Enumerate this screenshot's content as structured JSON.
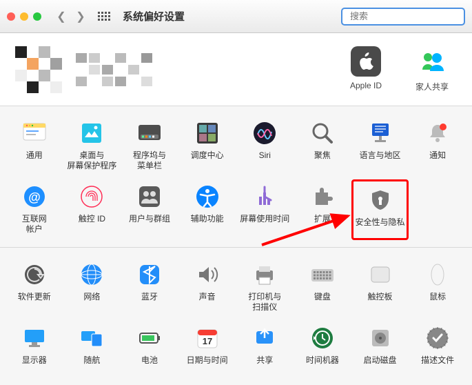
{
  "window": {
    "title": "系统偏好设置",
    "search_placeholder": "搜索"
  },
  "account": {
    "apple_id_label": "Apple ID",
    "family_label": "家人共享"
  },
  "section1": [
    {
      "id": "general",
      "label": "通用"
    },
    {
      "id": "desktop",
      "label": "桌面与\n屏幕保护程序"
    },
    {
      "id": "dock",
      "label": "程序坞与\n菜单栏"
    },
    {
      "id": "mission",
      "label": "调度中心"
    },
    {
      "id": "siri",
      "label": "Siri"
    },
    {
      "id": "spotlight",
      "label": "聚焦"
    },
    {
      "id": "language",
      "label": "语言与地区"
    },
    {
      "id": "notifications",
      "label": "通知"
    },
    {
      "id": "internet",
      "label": "互联网\n帐户"
    },
    {
      "id": "touchid",
      "label": "触控 ID"
    },
    {
      "id": "users",
      "label": "用户与群组"
    },
    {
      "id": "accessibility",
      "label": "辅助功能"
    },
    {
      "id": "screentime",
      "label": "屏幕使用时间"
    },
    {
      "id": "extensions",
      "label": "扩展"
    },
    {
      "id": "security",
      "label": "安全性与隐私"
    }
  ],
  "section2": [
    {
      "id": "update",
      "label": "软件更新"
    },
    {
      "id": "network",
      "label": "网络"
    },
    {
      "id": "bluetooth",
      "label": "蓝牙"
    },
    {
      "id": "sound",
      "label": "声音"
    },
    {
      "id": "printers",
      "label": "打印机与\n扫描仪"
    },
    {
      "id": "keyboard",
      "label": "键盘"
    },
    {
      "id": "trackpad",
      "label": "触控板"
    },
    {
      "id": "mouse",
      "label": "鼠标"
    },
    {
      "id": "displays",
      "label": "显示器"
    },
    {
      "id": "sidecar",
      "label": "随航"
    },
    {
      "id": "battery",
      "label": "电池"
    },
    {
      "id": "datetime",
      "label": "日期与时间"
    },
    {
      "id": "sharing",
      "label": "共享"
    },
    {
      "id": "timemachine",
      "label": "时间机器"
    },
    {
      "id": "startup",
      "label": "启动磁盘"
    },
    {
      "id": "profiles",
      "label": "描述文件"
    }
  ],
  "highlight_id": "security"
}
